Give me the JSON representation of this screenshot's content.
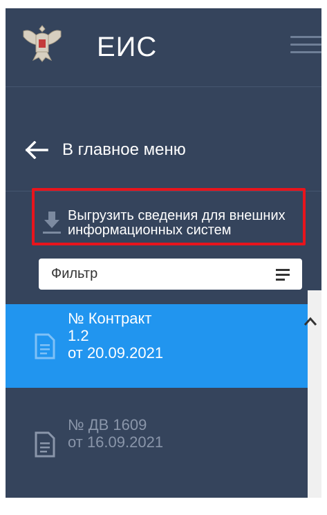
{
  "app": {
    "title": "ЕИС"
  },
  "nav": {
    "back_label": "В главное меню"
  },
  "export": {
    "label": "Выгрузить сведения для внешних информационных систем"
  },
  "filter": {
    "label": "Фильтр"
  },
  "documents": [
    {
      "title": "№ Контракт",
      "number": "1.2",
      "date": "от 20.09.2021",
      "selected": true
    },
    {
      "title": "№ ДВ 1609",
      "date": "от 16.09.2021",
      "selected": false
    }
  ],
  "colors": {
    "panel": "#35445c",
    "selected": "#2195ef",
    "highlight_border": "#e8141c"
  },
  "icons": [
    "emblem-icon",
    "menu-icon",
    "arrow-left-icon",
    "download-icon",
    "filter-icon",
    "document-icon",
    "chevron-up-icon"
  ]
}
